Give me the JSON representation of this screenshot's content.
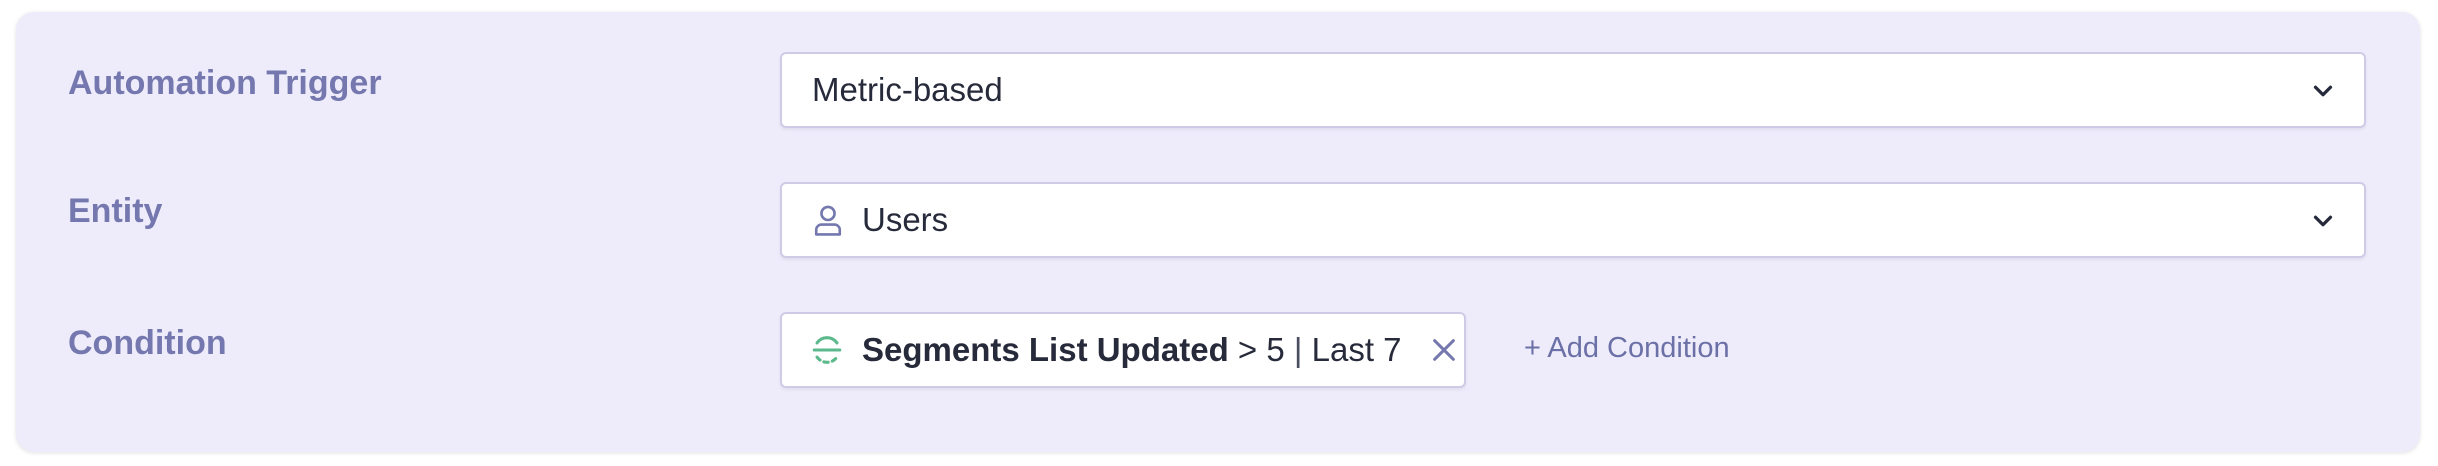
{
  "rows": {
    "trigger": {
      "label": "Automation Trigger",
      "value": "Metric-based"
    },
    "entity": {
      "label": "Entity",
      "value": "Users",
      "icon": "user-icon"
    },
    "condition": {
      "label": "Condition",
      "chip": {
        "icon": "segments-icon",
        "name": "Segments List Updated",
        "operator_text": " > 5 ",
        "separator": "|",
        "period_text": " Last 7"
      },
      "add_label": "+ Add Condition"
    }
  },
  "colors": {
    "panel_bg": "#eeecfb",
    "label": "#7478ae",
    "text": "#262a3a",
    "accent_green": "#5bb98c",
    "link": "#6b70a6"
  }
}
